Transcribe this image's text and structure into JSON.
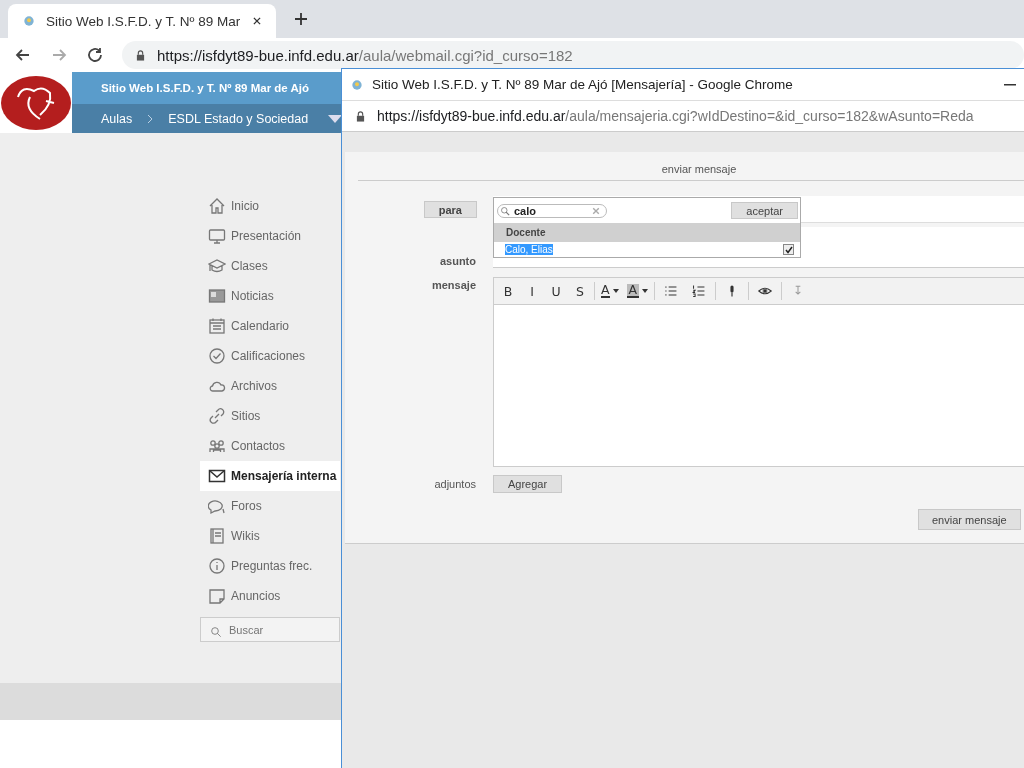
{
  "browser": {
    "tab": {
      "title": "Sitio Web I.S.F.D. y T. Nº 89 Mar"
    },
    "url": {
      "host": "https://isfdyt89-bue.infd.edu.ar",
      "path": "/aula/webmail.cgi?id_curso=182"
    }
  },
  "site": {
    "title": "Sitio Web I.S.F.D. y T. Nº 89 Mar de Ajó",
    "breadcrumb": [
      "Aulas",
      "ESDL Estado y Sociedad"
    ]
  },
  "sidebar": {
    "items": [
      {
        "kind": "home",
        "label": "Inicio",
        "selected": false
      },
      {
        "kind": "monitor",
        "label": "Presentación",
        "selected": false
      },
      {
        "kind": "cap",
        "label": "Clases",
        "selected": false
      },
      {
        "kind": "news",
        "label": "Noticias",
        "selected": false
      },
      {
        "kind": "calendar",
        "label": "Calendario",
        "selected": false
      },
      {
        "kind": "check",
        "label": "Calificaciones",
        "selected": false
      },
      {
        "kind": "cloud",
        "label": "Archivos",
        "selected": false
      },
      {
        "kind": "link",
        "label": "Sitios",
        "selected": false
      },
      {
        "kind": "people",
        "label": "Contactos",
        "selected": false
      },
      {
        "kind": "mail",
        "label": "Mensajería interna",
        "selected": true
      },
      {
        "kind": "chat",
        "label": "Foros",
        "selected": false
      },
      {
        "kind": "book",
        "label": "Wikis",
        "selected": false
      },
      {
        "kind": "info",
        "label": "Preguntas frec.",
        "selected": false
      },
      {
        "kind": "note",
        "label": "Anuncios",
        "selected": false
      }
    ],
    "search": {
      "placeholder": "Buscar"
    }
  },
  "popup": {
    "title": "Sitio Web I.S.F.D. y T. Nº 89 Mar de Ajó [Mensajería] - Google Chrome",
    "url": {
      "host": "https://isfdyt89-bue.infd.edu.ar",
      "path": "/aula/mensajeria.cgi?wIdDestino=&id_curso=182&wAsunto=Reda"
    },
    "heading": "enviar mensaje",
    "to_button": "para",
    "subject_label": "asunto",
    "message_label": "mensaje",
    "attachments_label": "adjuntos",
    "add_button": "Agregar",
    "send_button": "enviar mensaje",
    "recipient_picker": {
      "search": {
        "value": "calo"
      },
      "accept_button": "aceptar",
      "group": "Docente",
      "options": [
        {
          "label": "Calo, Elias",
          "selected": true,
          "checked": true
        }
      ]
    },
    "toolbar": [
      {
        "kind": "letter",
        "label": "B"
      },
      {
        "kind": "letter",
        "label": "I"
      },
      {
        "kind": "letter",
        "label": "U"
      },
      {
        "kind": "letter",
        "label": "S"
      },
      {
        "kind": "sep"
      },
      {
        "kind": "text-color",
        "label": "A"
      },
      {
        "kind": "highlight",
        "label": "A"
      },
      {
        "kind": "sep"
      },
      {
        "kind": "bullets"
      },
      {
        "kind": "numbers"
      },
      {
        "kind": "sep"
      },
      {
        "kind": "mic"
      },
      {
        "kind": "sep"
      },
      {
        "kind": "eye"
      },
      {
        "kind": "sep"
      },
      {
        "kind": "more"
      }
    ]
  }
}
